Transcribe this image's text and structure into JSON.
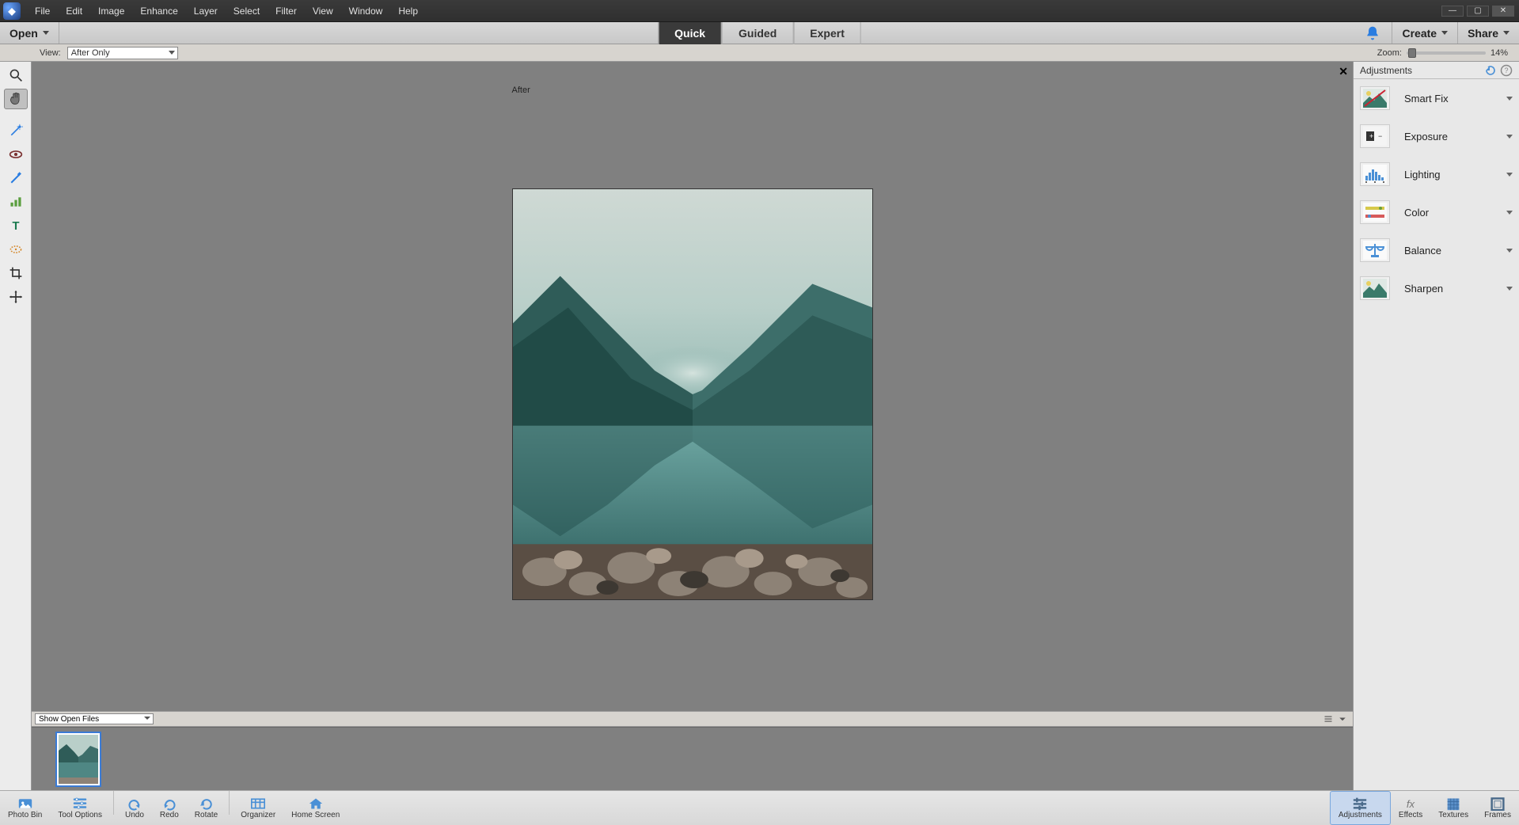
{
  "menubar": {
    "items": [
      "File",
      "Edit",
      "Image",
      "Enhance",
      "Layer",
      "Select",
      "Filter",
      "View",
      "Window",
      "Help"
    ]
  },
  "actionbar": {
    "open_label": "Open",
    "modes": [
      "Quick",
      "Guided",
      "Expert"
    ],
    "active_mode_index": 0,
    "create_label": "Create",
    "share_label": "Share"
  },
  "viewbar": {
    "label": "View:",
    "selected": "After Only",
    "zoom_label": "Zoom:",
    "zoom_value": "14%"
  },
  "canvas": {
    "after_label": "After"
  },
  "photobin": {
    "selector": "Show Open Files"
  },
  "adjustments": {
    "header": "Adjustments",
    "items": [
      {
        "label": "Smart Fix",
        "icon": "smartfix"
      },
      {
        "label": "Exposure",
        "icon": "exposure"
      },
      {
        "label": "Lighting",
        "icon": "lighting"
      },
      {
        "label": "Color",
        "icon": "color"
      },
      {
        "label": "Balance",
        "icon": "balance"
      },
      {
        "label": "Sharpen",
        "icon": "sharpen"
      }
    ]
  },
  "bottombar": {
    "left": [
      {
        "label": "Photo Bin",
        "icon": "photobin"
      },
      {
        "label": "Tool Options",
        "icon": "tooloptions"
      },
      {
        "label": "Undo",
        "icon": "undo"
      },
      {
        "label": "Redo",
        "icon": "redo"
      },
      {
        "label": "Rotate",
        "icon": "rotate"
      },
      {
        "label": "Organizer",
        "icon": "organizer"
      },
      {
        "label": "Home Screen",
        "icon": "home"
      }
    ],
    "right": [
      {
        "label": "Adjustments",
        "icon": "adjustments"
      },
      {
        "label": "Effects",
        "icon": "effects"
      },
      {
        "label": "Textures",
        "icon": "textures"
      },
      {
        "label": "Frames",
        "icon": "frames"
      }
    ],
    "active_right_index": 0
  },
  "tools": [
    {
      "name": "zoom",
      "icon": "zoom"
    },
    {
      "name": "hand",
      "icon": "hand"
    },
    {
      "name": "quick-select",
      "icon": "wand"
    },
    {
      "name": "eye",
      "icon": "eye"
    },
    {
      "name": "whiten",
      "icon": "brush"
    },
    {
      "name": "auto",
      "icon": "auto"
    },
    {
      "name": "text",
      "icon": "text"
    },
    {
      "name": "spot",
      "icon": "spot"
    },
    {
      "name": "crop",
      "icon": "crop"
    },
    {
      "name": "move",
      "icon": "move"
    }
  ],
  "active_tool_index": 1
}
